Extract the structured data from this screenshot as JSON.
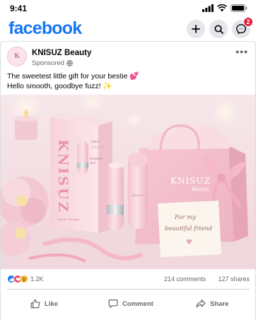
{
  "status": {
    "time": "9:41"
  },
  "app": {
    "logo": "facebook",
    "messenger_badge": "2",
    "icons": [
      "plus-icon",
      "search-icon",
      "messenger-icon"
    ]
  },
  "post": {
    "page_name": "KNISUZ Beauty",
    "avatar_text": "K",
    "sponsored": "Sponsored",
    "caption_line1": "The sweetest little gift for your bestie 💕",
    "caption_line2": "Hello smooth, goodbye fuzz! ✨",
    "image": {
      "box_brand": "KNISUZ",
      "box_small_text_1": "Hello",
      "box_small_text_2": "Smooth",
      "box_small_text_3": "Goodbye",
      "box_small_text_4": "Hair",
      "box_small_text_5": "Gentle • Painless",
      "bag_brand": "KNISUZ",
      "bag_sub": "Beauty",
      "device_brand": "KNISUZ",
      "card_line1": "For my",
      "card_line2": "beautiful friend",
      "card_heart": "♥"
    },
    "reaction_count": "1.2K",
    "comments": "214 comments",
    "shares": "127 shares",
    "actions": {
      "like": "Like",
      "comment": "Comment",
      "share": "Share"
    }
  },
  "colors": {
    "brand": "#1877f2",
    "accent_pink": "#f3c3cf",
    "text_secondary": "#65676b"
  }
}
